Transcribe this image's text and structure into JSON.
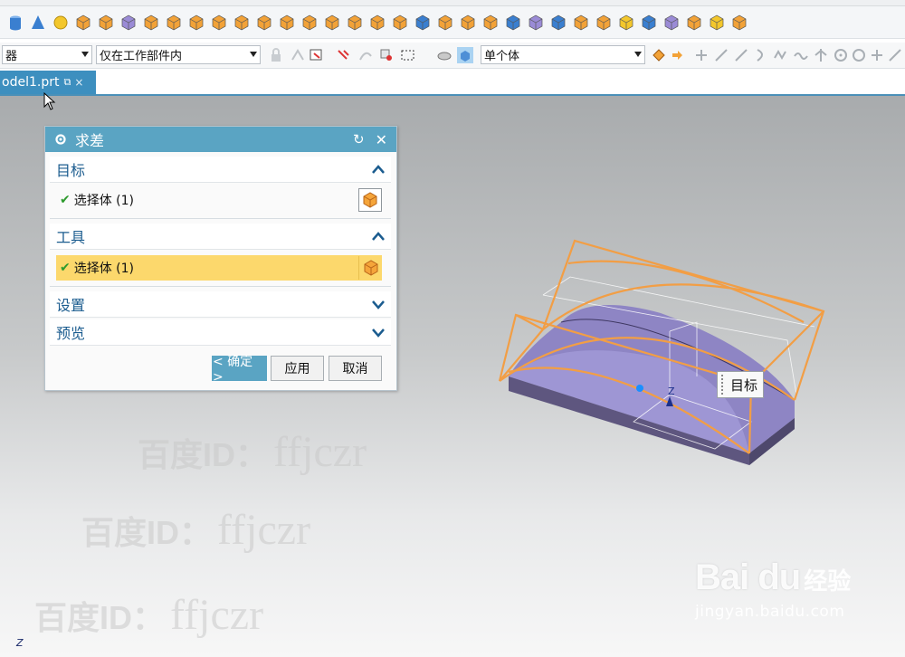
{
  "toolbar_icons": [
    "cylinder-icon",
    "cone-icon",
    "sphere-icon",
    "tube-icon",
    "rib-icon",
    "nx5-feature-icon",
    "pad-icon",
    "boss-icon",
    "pocket-icon",
    "slot-icon",
    "groove-icon",
    "hole-icon",
    "extract-body-icon",
    "thicken-icon",
    "offset-face-icon",
    "emboss-icon",
    "shell-icon",
    "pattern-feature-icon",
    "mirror-feature-icon",
    "draft-icon",
    "trim-body-icon",
    "split-body-icon",
    "sew-icon",
    "unite-icon",
    "subtract-icon",
    "intersect-icon",
    "edge-blend-icon",
    "chamfer-icon",
    "face-blend-icon",
    "offset-region-icon",
    "replace-face-icon",
    "move-face-icon",
    "delete-face-icon"
  ],
  "icon_colors": {
    "orange": "#f2a238",
    "blue": "#3a7fd0",
    "yellow": "#f3c72c",
    "purple": "#9a8bd6"
  },
  "filter_bar": {
    "type_filter_value": "器",
    "scope_filter_value": "仅在工作部件内",
    "body_rule_value": "单个体"
  },
  "tab": {
    "name": "odel1.prt",
    "pin_symbol": "⧉",
    "close_symbol": "×"
  },
  "dialog": {
    "title": "求差",
    "target_group": {
      "label": "目标",
      "selection_label": "选择体 (1)"
    },
    "tool_group": {
      "label": "工具",
      "selection_label": "选择体 (1)"
    },
    "settings_group": {
      "label": "设置"
    },
    "preview_group": {
      "label": "预览"
    },
    "ok_label": "< 确定 >",
    "apply_label": "应用",
    "cancel_label": "取消"
  },
  "viewport": {
    "target_tooltip": "目标",
    "z_axis_label": "Z",
    "triad_label": "Z",
    "watermark_prefix": "百度ID：",
    "watermark_user": "ffjczr",
    "baidu_logo": "Bai du",
    "baidu_jingyan": "经验",
    "baidu_url": "jingyan.baidu.com"
  },
  "colors": {
    "accent": "#5aa4c3",
    "highlight": "#fcd86c",
    "tool_outline": "#f29e45",
    "body_fill": "#8e85c4",
    "check": "#2e9b2e"
  }
}
